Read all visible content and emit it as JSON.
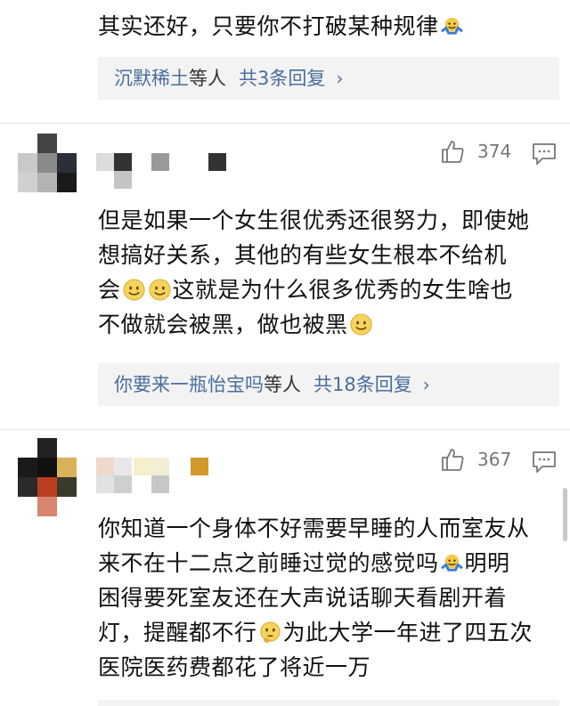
{
  "comments": [
    {
      "text_before": "其实还好，只要你不打破某种规律",
      "emoji": "shrug-emoji",
      "replies": {
        "who": "沉默稀土",
        "etc": "等人",
        "count": "共3条回复",
        "chev": "›"
      }
    },
    {
      "likes": "374",
      "line1": "但是如果一个女生很优秀还很努力，即使她",
      "line2": "想搞好关系，其他的有些女生根本不给机",
      "line3a": "会",
      "line3b": "这就是为什么很多优秀的女生啥也",
      "line4": "不做就会被黑，做也被黑",
      "replies": {
        "who": "你要来一瓶怡宝吗",
        "etc": "等人",
        "count": "共18条回复",
        "chev": "›"
      }
    },
    {
      "likes": "367",
      "line1": "你知道一个身体不好需要早睡的人而室友从",
      "line2a": "来不在十二点之前睡过觉的感觉吗",
      "line2b": "明明",
      "line3": "困得要死室友还在大声说话聊天看剧开着",
      "line4a": "灯，提醒都不行",
      "line4b": "为此大学一年进了四五次",
      "line5": "医院医药费都花了将近一万"
    }
  ],
  "colors": {
    "link": "#4a6e9c",
    "reply_bg": "#f3f3f3",
    "meta": "#777777"
  }
}
